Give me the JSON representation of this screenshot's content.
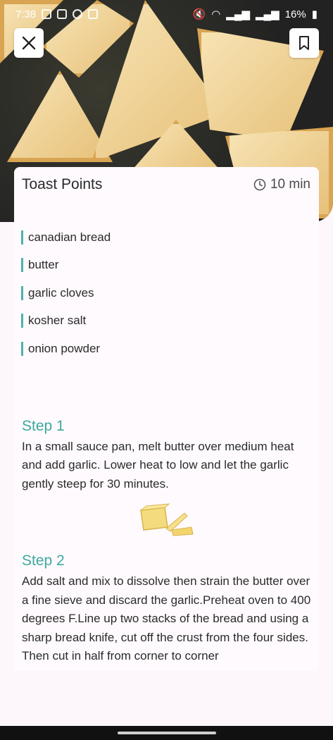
{
  "status_bar": {
    "time": "7:38",
    "battery": "16%"
  },
  "recipe": {
    "title": "Toast Points",
    "time": "10 min"
  },
  "ingredients": [
    "canadian bread",
    "butter",
    "garlic cloves",
    "kosher salt",
    "onion powder"
  ],
  "steps": [
    {
      "title": "Step 1",
      "text": "In a small sauce pan, melt butter over medium heat and add garlic. Lower heat to low and let the garlic gently steep for 30 minutes."
    },
    {
      "title": "Step 2",
      "text": "Add salt and mix to dissolve then strain the butter over a fine sieve and discard the garlic.Preheat oven to 400 degrees F.Line up two stacks of the bread and using a sharp bread knife, cut off the crust from the four sides. Then cut in half from corner to corner"
    }
  ],
  "colors": {
    "accent": "#3ea99e"
  },
  "icons": {
    "close": "close-icon",
    "bookmark": "bookmark-icon",
    "clock": "clock-icon"
  }
}
